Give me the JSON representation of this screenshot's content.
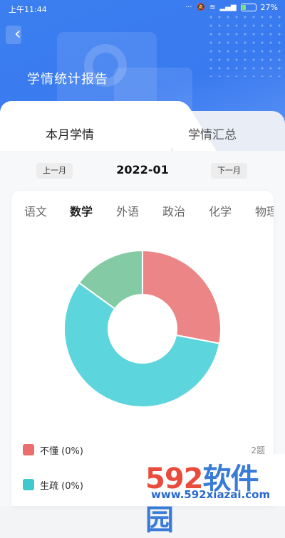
{
  "status_bar": {
    "time": "上午11:44",
    "battery": "27%"
  },
  "header": {
    "title": "学情统计报告"
  },
  "tabs": [
    {
      "label": "本月学情"
    },
    {
      "label": "学情汇总"
    }
  ],
  "month_nav": {
    "prev_label": "上一月",
    "current": "2022-01",
    "next_label": "下一月"
  },
  "subjects": [
    "语文",
    "数学",
    "外语",
    "政治",
    "化学",
    "物理"
  ],
  "selected_subject": "数学",
  "chart_data": {
    "type": "pie",
    "donut": true,
    "slices": [
      {
        "value": 28,
        "color": "#ec8686"
      },
      {
        "value": 57,
        "color": "#5dd5dc"
      },
      {
        "value": 15,
        "color": "#84cba5"
      }
    ]
  },
  "legend": [
    {
      "label": "不懂 (0%)",
      "count": "2题",
      "color": "#ec6d6d"
    },
    {
      "label": "生疏 (0%)",
      "count": "",
      "color": "#3fc9cf"
    }
  ],
  "watermark": {
    "big_num": "592",
    "big_text": "软件园",
    "url": "www.592xiazai.com"
  }
}
